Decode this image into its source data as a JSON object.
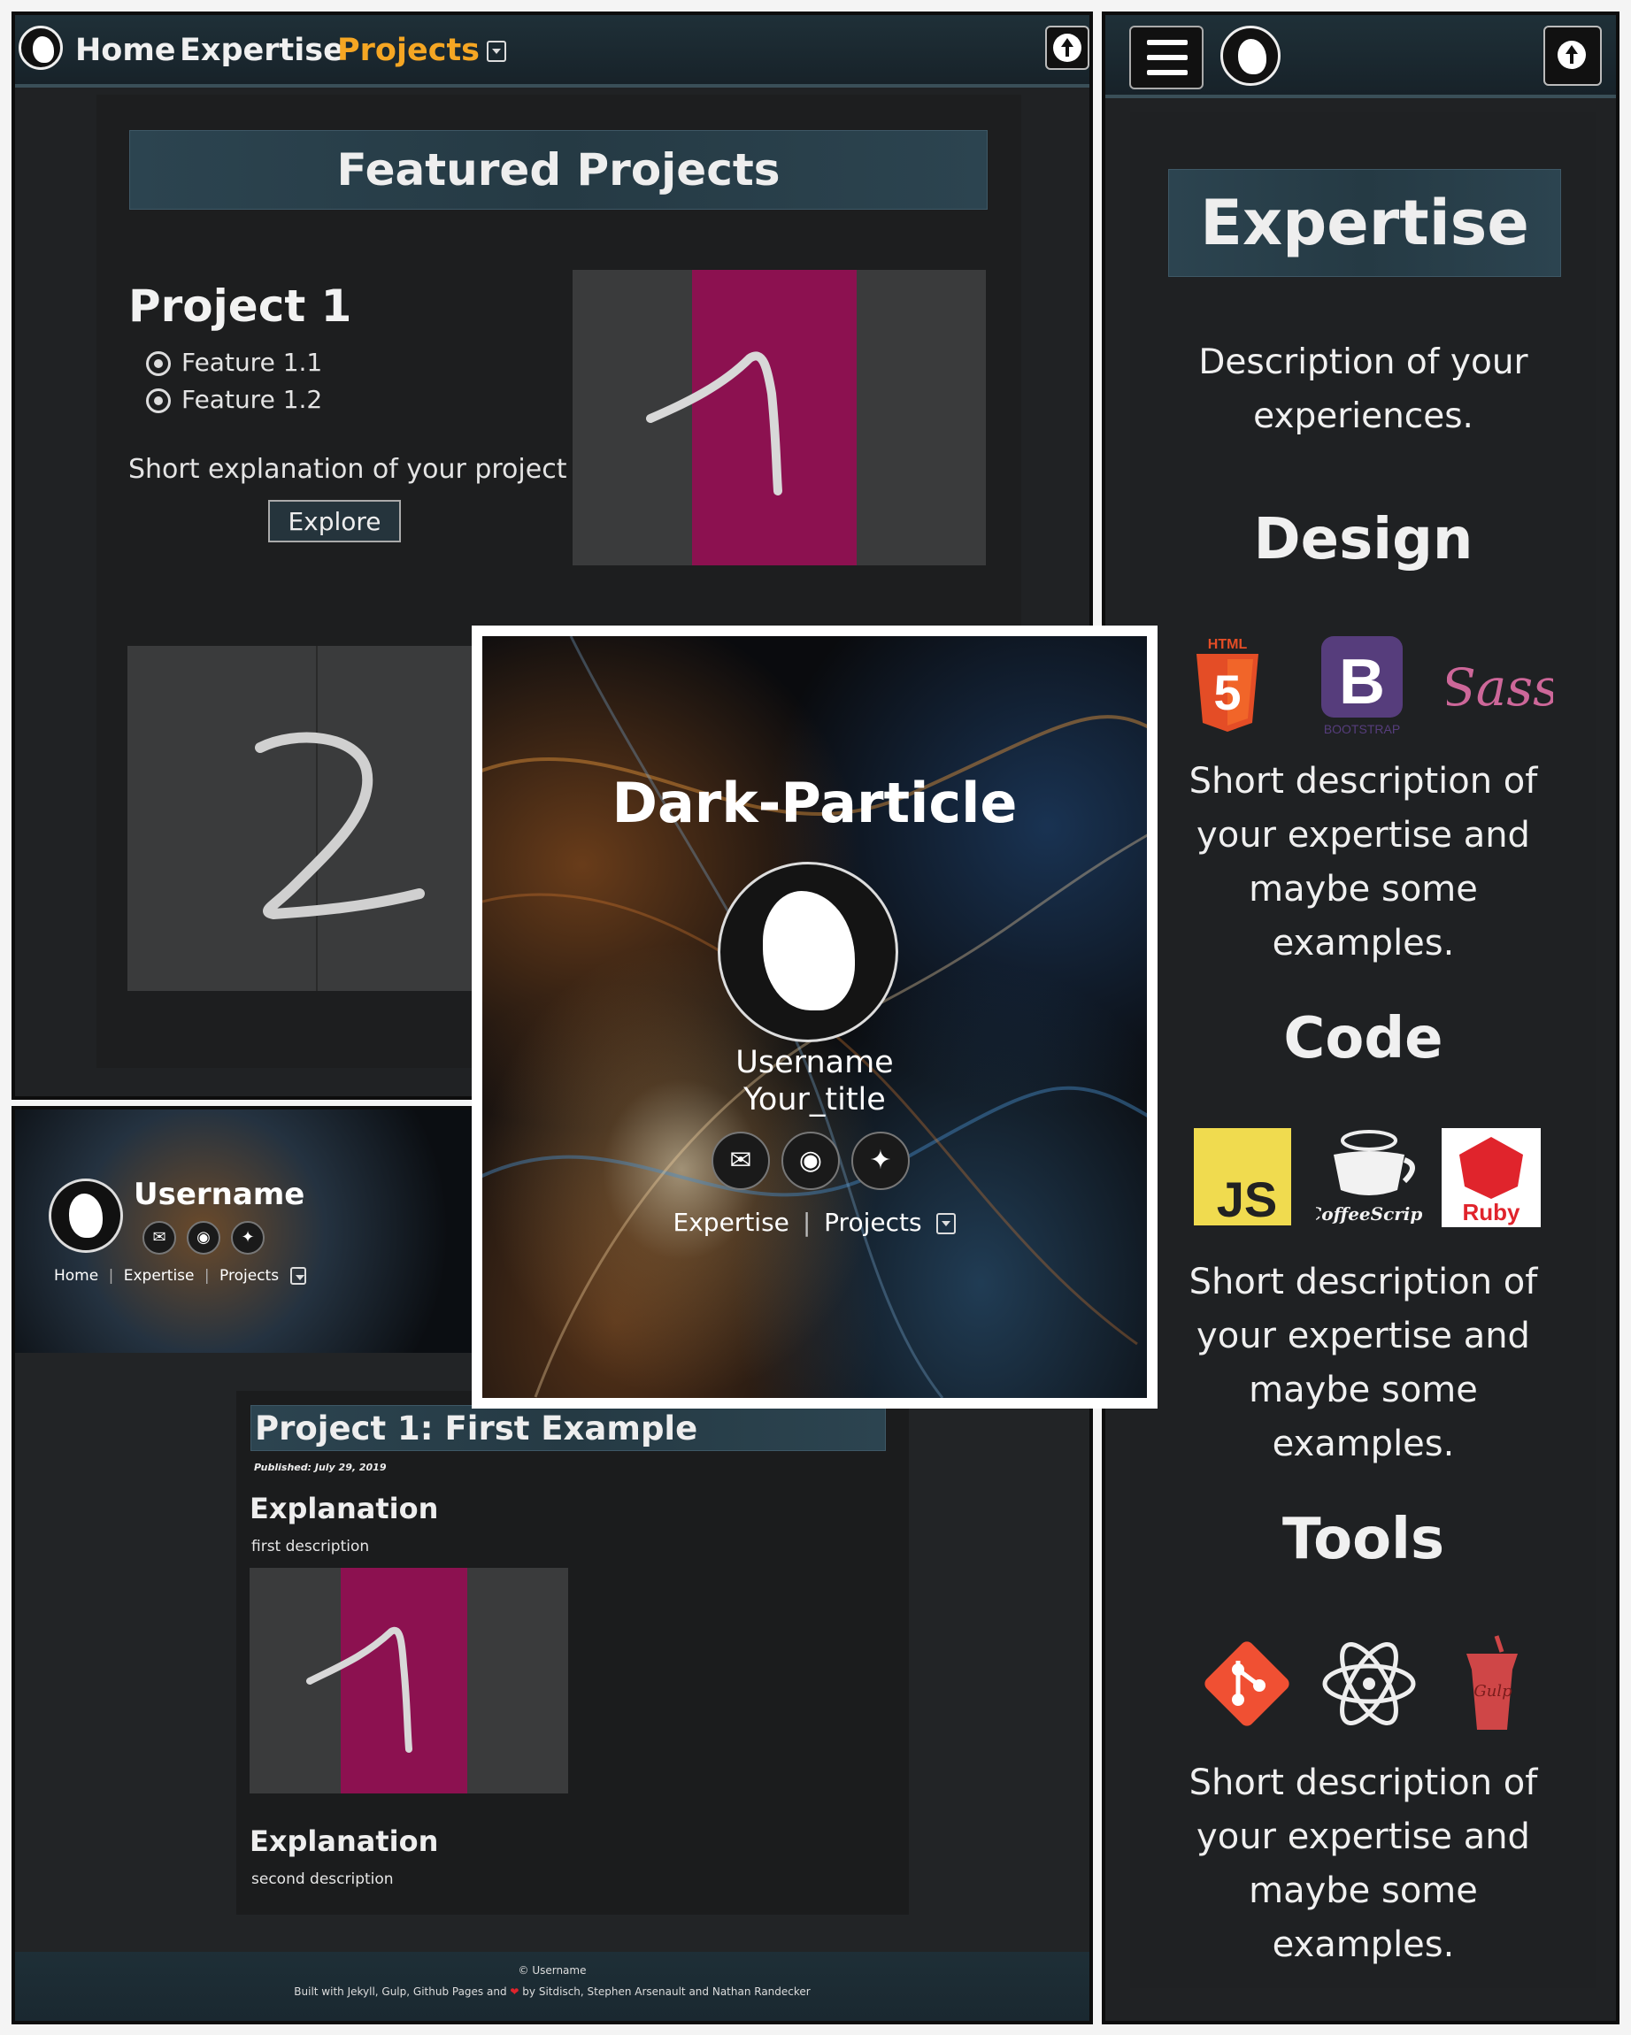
{
  "projects_page": {
    "nav": {
      "home": "Home",
      "expertise": "Expertise",
      "projects": "Projects"
    },
    "heading": "Featured Projects",
    "project1": {
      "title": "Project 1",
      "features": [
        "Feature 1.1",
        "Feature 1.2"
      ],
      "description": "Short explanation of your project",
      "button": "Explore"
    },
    "project1_image_digit": "1",
    "project2_image_digit": "2"
  },
  "expertise_page": {
    "heading": "Expertise",
    "intro": "Description of your experiences.",
    "sections": [
      {
        "title": "Design",
        "logos": [
          "html5-logo",
          "bootstrap-logo",
          "sass-logo"
        ],
        "logo_text": {
          "html": "HTML",
          "html_num": "5",
          "bootstrap": "B",
          "bootstrap_caption": "BOOTSTRAP",
          "sass": "Sass"
        },
        "text": "Short description of your expertise and maybe some examples."
      },
      {
        "title": "Code",
        "logos": [
          "javascript-logo",
          "coffeescript-logo",
          "ruby-logo"
        ],
        "logo_text": {
          "js": "JS",
          "coffee": "CoffeeScript",
          "ruby": "Ruby"
        },
        "text": "Short description of your expertise and maybe some examples."
      },
      {
        "title": "Tools",
        "logos": [
          "git-logo",
          "atom-logo",
          "gulp-logo"
        ],
        "logo_text": {
          "gulp": "Gulp"
        },
        "text": "Short description of your expertise and maybe some examples."
      }
    ]
  },
  "hero": {
    "title": "Dark-Particle",
    "username": "Username",
    "user_title": "Your_title",
    "links": {
      "expertise": "Expertise",
      "projects": "Projects"
    },
    "social": [
      "envelope-icon",
      "github-icon",
      "twitter-icon"
    ]
  },
  "post_page": {
    "header": {
      "username": "Username",
      "nav": {
        "home": "Home",
        "expertise": "Expertise",
        "projects": "Projects"
      }
    },
    "title": "Project 1: First Example",
    "published": "Published: July 29, 2019",
    "sections": [
      {
        "heading": "Explanation",
        "text": "first description"
      },
      {
        "heading": "Explanation",
        "text": "second description"
      }
    ],
    "footer": {
      "copyright": "© Username",
      "credits_prefix": "Built with Jekyll, Gulp, Github Pages and",
      "credits_suffix": "by Sitdisch, Stephen Arsenault and Nathan Randecker"
    }
  },
  "colors": {
    "accent": "#f5a623",
    "heading_bar": "#2c4450",
    "background": "#202224",
    "mnist_stripe": "#8c1150"
  }
}
